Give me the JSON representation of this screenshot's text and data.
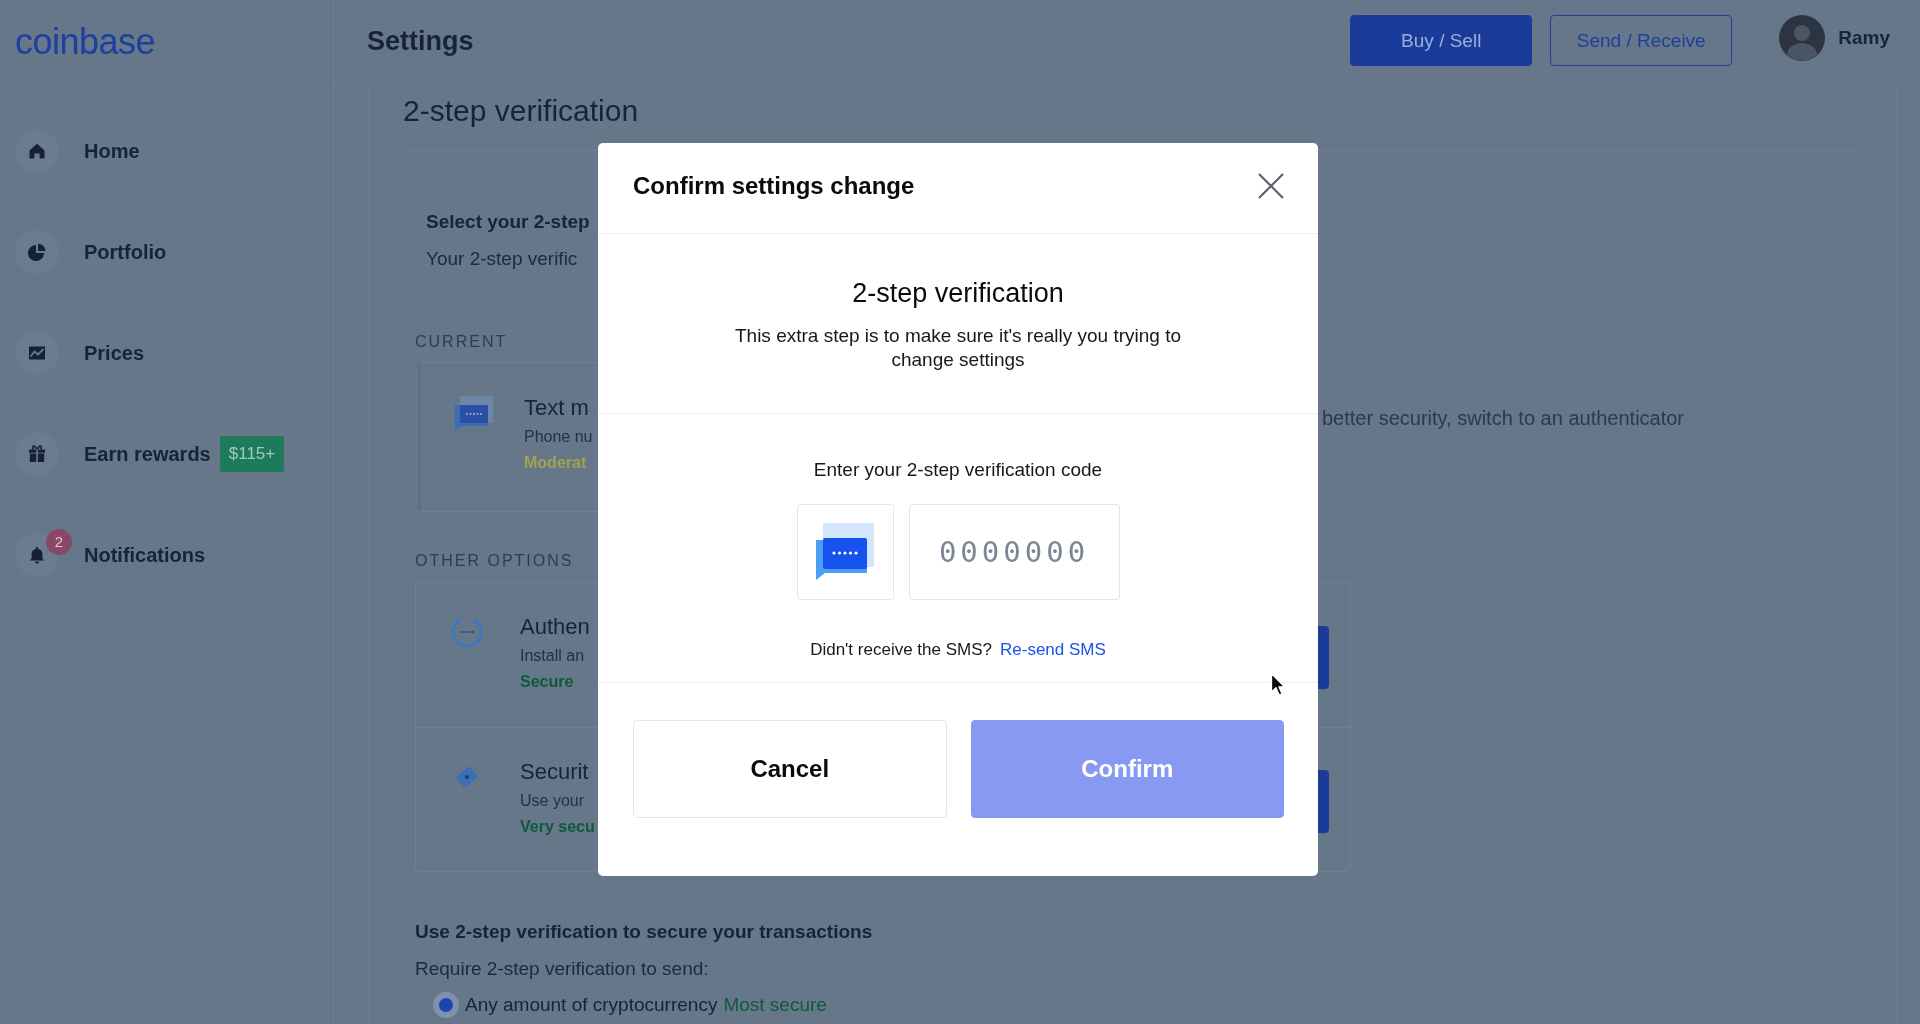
{
  "sidebar": {
    "logo": "coinbase",
    "items": [
      {
        "label": "Home",
        "selected": false
      },
      {
        "label": "Portfolio",
        "selected": false
      },
      {
        "label": "Prices",
        "selected": false
      },
      {
        "label": "Earn rewards",
        "selected": false,
        "badge": "$115+"
      },
      {
        "label": "Notifications",
        "selected": false,
        "count": "2"
      }
    ]
  },
  "header": {
    "title": "Settings",
    "buttons": [
      {
        "label": "Buy / Sell",
        "kind": "primary"
      },
      {
        "label": "Send / Receive",
        "kind": "outline"
      }
    ],
    "user": {
      "name": "Ramy"
    }
  },
  "page": {
    "heading": "2-step verification",
    "intro": {
      "title": "Select your 2-step",
      "text": "Your 2-step verific"
    },
    "current": {
      "label": "CURRENT",
      "method": {
        "title": "Text m",
        "subtitle": "Phone nu",
        "rating": "Moderat",
        "color": "#a2a34c"
      },
      "note": "better security, switch to an authenticator"
    },
    "other": {
      "label": "OTHER OPTIONS",
      "methods": [
        {
          "title": "Authen",
          "subtitle": "Install an",
          "rating": "Secure",
          "color": "#0e5a3a"
        },
        {
          "title": "Securit",
          "subtitle": "Use your",
          "rating": "Very secu",
          "color": "#0e5a3a"
        }
      ]
    },
    "transactions": {
      "title": "Use 2-step verification to secure your transactions",
      "text": "Require 2-step verification to send:",
      "options": [
        {
          "label": "Any amount of cryptocurrency",
          "tag": "Most secure",
          "selected": true
        }
      ]
    }
  },
  "modal": {
    "title": "Confirm settings change",
    "heading": "2-step verification",
    "description": "This extra step is to make sure it's really you trying to change settings",
    "code_prompt": "Enter your 2-step verification code",
    "code_field": {
      "placeholder": "0000000"
    },
    "resend_prompt": "Didn't receive the SMS?",
    "resend_link": "Re-send SMS",
    "buttons": [
      {
        "label": "Cancel",
        "kind": "secondary",
        "disabled": false
      },
      {
        "label": "Confirm",
        "kind": "primary",
        "disabled": true
      }
    ]
  }
}
